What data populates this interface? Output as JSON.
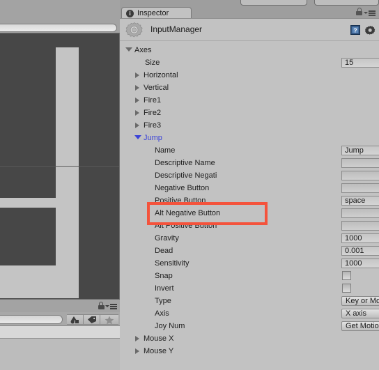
{
  "window": {
    "tab_label": "Inspector",
    "tab_icon": "info-icon",
    "lock_icon": "lock-icon",
    "menu_icon": "hamburger-menu-icon"
  },
  "asset": {
    "name": "InputManager",
    "icon": "gear-cog-icon",
    "help_icon": "help-book-icon",
    "settings_icon": "gear-icon"
  },
  "axes": {
    "root_label": "Axes",
    "size_label": "Size",
    "size_value": "15",
    "collapsed_entries": [
      {
        "label": "Horizontal"
      },
      {
        "label": "Vertical"
      },
      {
        "label": "Fire1"
      },
      {
        "label": "Fire2"
      },
      {
        "label": "Fire3"
      }
    ],
    "expanded_entry": {
      "label": "Jump",
      "properties": [
        {
          "label": "Name",
          "value": "Jump",
          "type": "text"
        },
        {
          "label": "Descriptive Name",
          "value": "",
          "type": "text"
        },
        {
          "label": "Descriptive Negati",
          "value": "",
          "type": "text"
        },
        {
          "label": "Negative Button",
          "value": "",
          "type": "text"
        },
        {
          "label": "Positive Button",
          "value": "space",
          "type": "text"
        },
        {
          "label": "Alt Negative Button",
          "value": "",
          "type": "text"
        },
        {
          "label": "Alt Positive Button",
          "value": "",
          "type": "text"
        },
        {
          "label": "Gravity",
          "value": "1000",
          "type": "text"
        },
        {
          "label": "Dead",
          "value": "0.001",
          "type": "text"
        },
        {
          "label": "Sensitivity",
          "value": "1000",
          "type": "text"
        },
        {
          "label": "Snap",
          "value": "",
          "type": "checkbox"
        },
        {
          "label": "Invert",
          "value": "",
          "type": "checkbox"
        },
        {
          "label": "Type",
          "value": "Key or Mouse Button",
          "type": "dropdown"
        },
        {
          "label": "Axis",
          "value": "X axis",
          "type": "dropdown"
        },
        {
          "label": "Joy Num",
          "value": "Get Motion from all Joysticks",
          "type": "dropdown"
        }
      ]
    },
    "trailing_entries": [
      {
        "label": "Mouse X"
      },
      {
        "label": "Mouse Y"
      }
    ]
  },
  "annotation": {
    "highlight_color": "#f4533c",
    "target": "Positive Button"
  },
  "left_panel": {
    "toolbar_buttons": [
      {
        "icon": "shapes-icon"
      },
      {
        "icon": "tag-icon"
      },
      {
        "icon": "star-icon"
      }
    ],
    "search_placeholder": ""
  },
  "colors": {
    "background": "#c2c2c2",
    "chrome": "#9e9e9e",
    "viewport": "#474747",
    "accent_blue": "#3b43d8",
    "highlight_red": "#f4533c"
  }
}
